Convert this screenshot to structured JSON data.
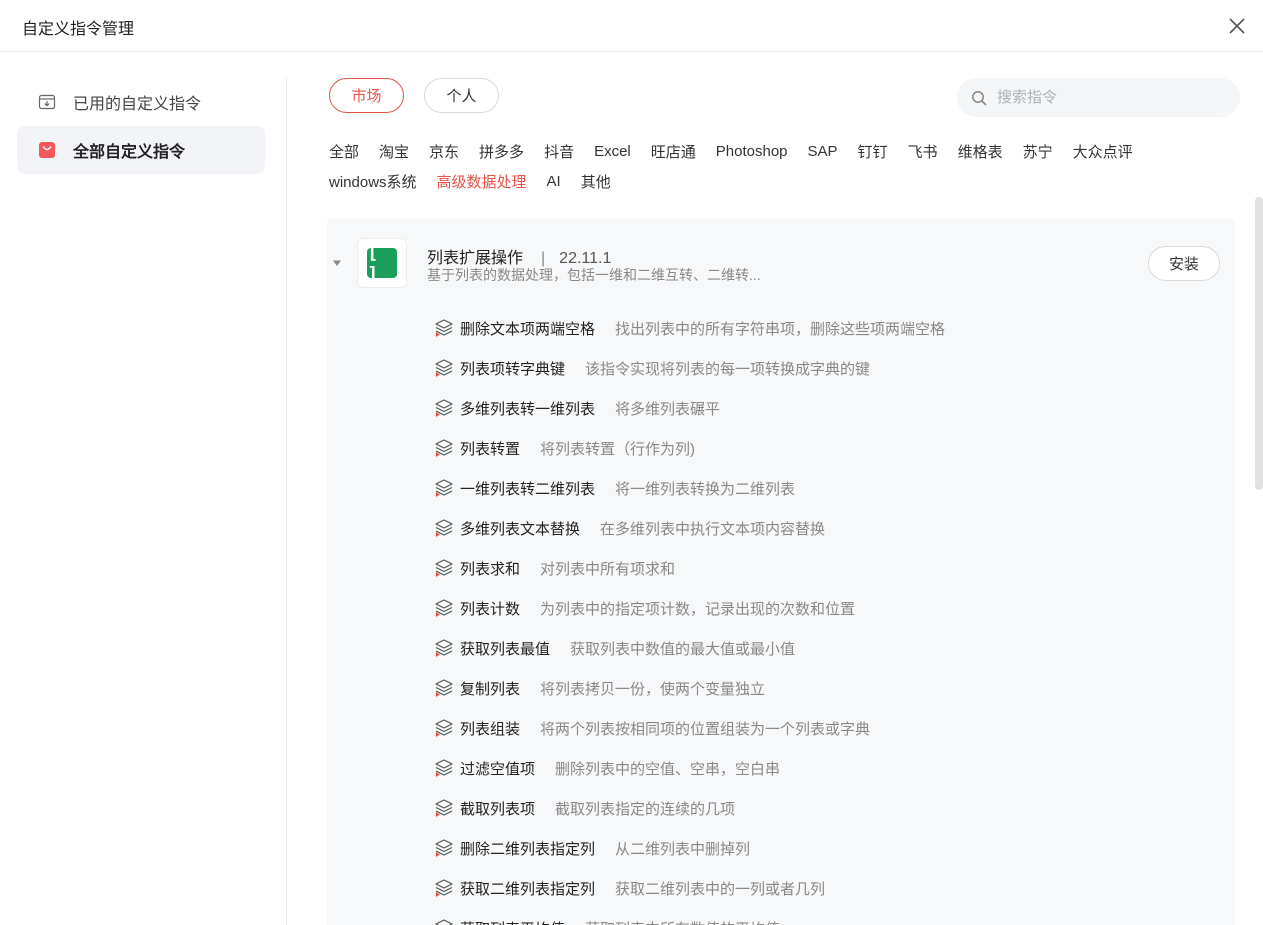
{
  "window": {
    "title": "自定义指令管理"
  },
  "sidebar": {
    "items": [
      {
        "label": "已用的自定义指令",
        "icon": "inbox-download-icon",
        "active": false
      },
      {
        "label": "全部自定义指令",
        "icon": "shopping-bag-icon",
        "active": true
      }
    ]
  },
  "tabs": {
    "market": "市场",
    "personal": "个人",
    "active": "market"
  },
  "search": {
    "placeholder": "搜索指令",
    "value": ""
  },
  "categories": {
    "row1": [
      "全部",
      "淘宝",
      "京东",
      "拼多多",
      "抖音",
      "Excel",
      "旺店通",
      "Photoshop",
      "SAP",
      "钉钉",
      "飞书",
      "维格表",
      "苏宁",
      "大众点评"
    ],
    "row2": [
      "windows系统",
      "高级数据处理",
      "AI",
      "其他"
    ],
    "active": "高级数据处理"
  },
  "package": {
    "name": "列表扩展操作",
    "separator": "|",
    "version": "22.11.1",
    "description": "基于列表的数据处理，包括一维和二维互转、二维转...",
    "install_label": "安装",
    "expanded": true,
    "logo_text": "[ ]",
    "logo_color": "#1aa05a"
  },
  "commands": [
    {
      "name": "删除文本项两端空格",
      "desc": "找出列表中的所有字符串项，删除这些项两端空格"
    },
    {
      "name": "列表项转字典键",
      "desc": "该指令实现将列表的每一项转换成字典的键"
    },
    {
      "name": "多维列表转一维列表",
      "desc": "将多维列表碾平"
    },
    {
      "name": "列表转置",
      "desc": "将列表转置（行作为列)"
    },
    {
      "name": "一维列表转二维列表",
      "desc": "将一维列表转换为二维列表"
    },
    {
      "name": "多维列表文本替换",
      "desc": "在多维列表中执行文本项内容替换"
    },
    {
      "name": "列表求和",
      "desc": "对列表中所有项求和"
    },
    {
      "name": "列表计数",
      "desc": "为列表中的指定项计数，记录出现的次数和位置"
    },
    {
      "name": "获取列表最值",
      "desc": "获取列表中数值的最大值或最小值"
    },
    {
      "name": "复制列表",
      "desc": "将列表拷贝一份，使两个变量独立"
    },
    {
      "name": "列表组装",
      "desc": "将两个列表按相同项的位置组装为一个列表或字典"
    },
    {
      "name": "过滤空值项",
      "desc": "删除列表中的空值、空串，空白串"
    },
    {
      "name": "截取列表项",
      "desc": "截取列表指定的连续的几项"
    },
    {
      "name": "删除二维列表指定列",
      "desc": "从二维列表中删掉列"
    },
    {
      "name": "获取二维列表指定列",
      "desc": "获取二维列表中的一列或者几列"
    },
    {
      "name": "获取列表平均值",
      "desc": "获取列表中所有数值的平均值"
    }
  ],
  "colors": {
    "accent": "#e85349",
    "active_bg": "#f3f4f8",
    "panel_bg": "#f7f8fa"
  }
}
